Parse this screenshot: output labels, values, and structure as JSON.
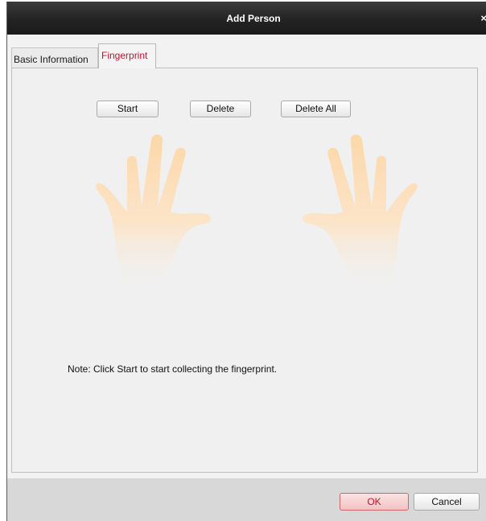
{
  "window": {
    "title": "Add Person",
    "close_symbol": "×"
  },
  "tabs": [
    {
      "label": "Basic Information",
      "active": false
    },
    {
      "label": "Fingerprint",
      "active": true
    }
  ],
  "fingerprint": {
    "buttons": {
      "start": "Start",
      "delete": "Delete",
      "delete_all": "Delete All"
    },
    "hands_image": "hands-icon",
    "note": "Note: Click Start to start collecting the fingerprint."
  },
  "footer": {
    "ok": "OK",
    "cancel": "Cancel"
  },
  "colors": {
    "titlebar": "#232323",
    "active_tab_text": "#c8102e",
    "hand": "#fcd7a8",
    "ok_border": "#c9686a"
  }
}
